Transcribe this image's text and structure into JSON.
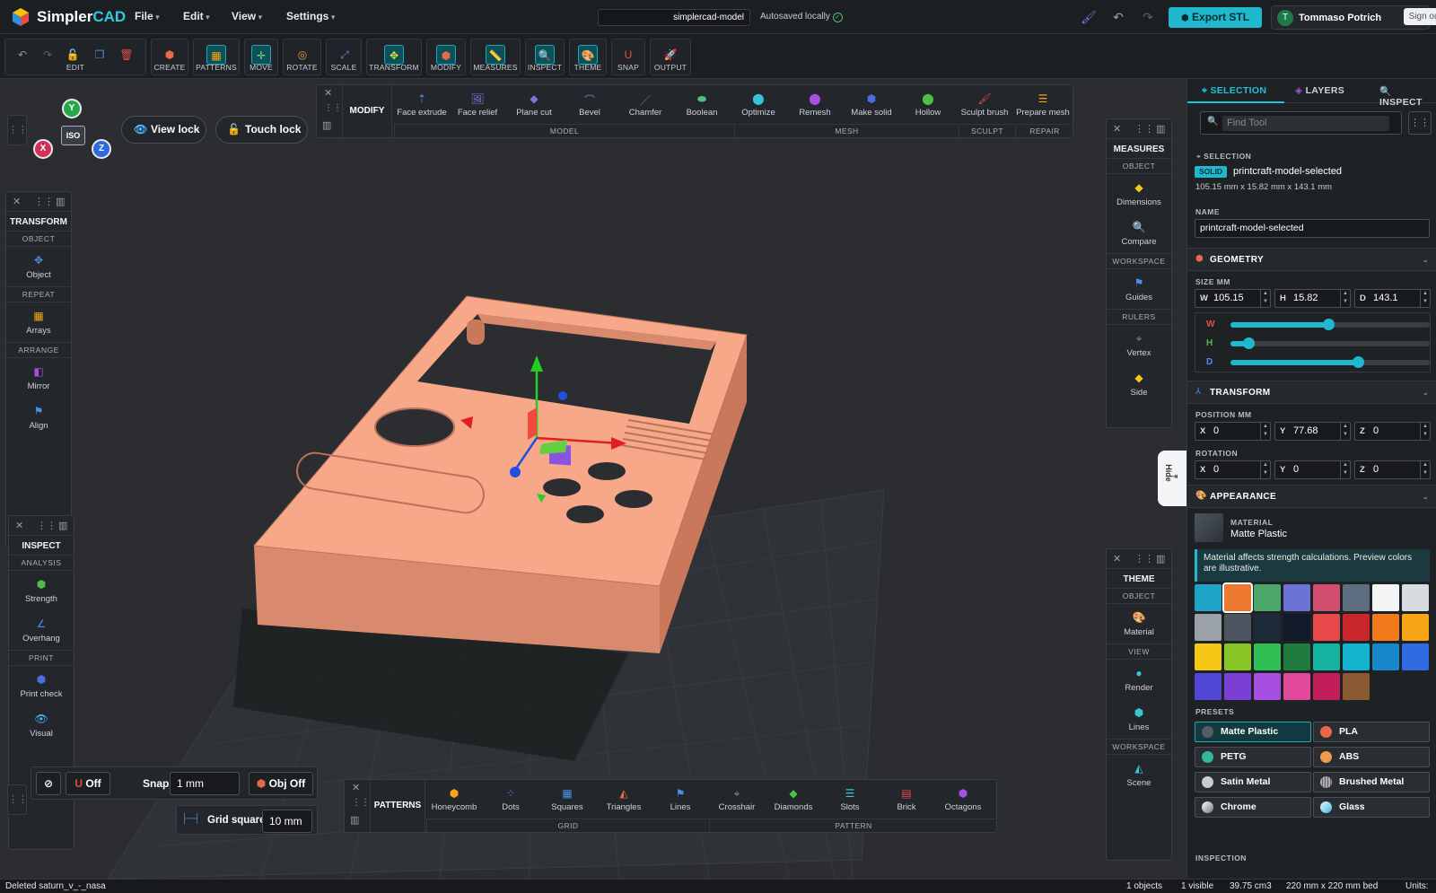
{
  "app": {
    "logo_plain": "Simpler",
    "logo_accent": "CAD"
  },
  "topbar": {
    "menus": [
      "File",
      "Edit",
      "View",
      "Settings"
    ],
    "model_name": "simplercad-model",
    "autosave": "Autosaved locally",
    "export_label": "Export STL",
    "user_initial": "T",
    "user_name": "Tommaso Potrich",
    "signout": "Sign out"
  },
  "ribbon": {
    "groups": [
      "EDIT",
      "CREATE",
      "PATTERNS",
      "MOVE",
      "ROTATE",
      "SCALE",
      "TRANSFORM",
      "MODIFY",
      "MEASURES",
      "INSPECT",
      "THEME",
      "SNAP",
      "OUTPUT"
    ]
  },
  "viewport": {
    "iso": "ISO",
    "axes": {
      "x": "X",
      "y": "Y",
      "z": "Z"
    },
    "view_lock": "View lock",
    "touch_lock": "Touch lock",
    "hide": "Hide"
  },
  "modify_bar": {
    "title": "MODIFY",
    "buttons": [
      "Face extrude",
      "Face relief",
      "Plane cut",
      "Bevel",
      "Chamfer",
      "Boolean",
      "Optimize",
      "Remesh",
      "Make solid",
      "Hollow",
      "Sculpt brush",
      "Prepare mesh"
    ],
    "sections": [
      "MODEL",
      "MESH",
      "SCULPT",
      "REPAIR"
    ]
  },
  "patterns_bar": {
    "title": "PATTERNS",
    "buttons": [
      "Honeycomb",
      "Dots",
      "Squares",
      "Triangles",
      "Lines",
      "Crosshair",
      "Diamonds",
      "Slots",
      "Brick",
      "Octagons"
    ],
    "sections": [
      "GRID",
      "PATTERN"
    ]
  },
  "transform_panel": {
    "title": "TRANSFORM",
    "sec1": "OBJECT",
    "item1": "Object",
    "sec2": "REPEAT",
    "item2": "Arrays",
    "sec3": "ARRANGE",
    "item3": "Mirror",
    "item4": "Align"
  },
  "inspect_panel": {
    "title": "INSPECT",
    "sec1": "ANALYSIS",
    "item1": "Strength",
    "item2": "Overhang",
    "sec2": "PRINT",
    "item3": "Print check",
    "item4": "Visual"
  },
  "measures_panel": {
    "title": "MEASURES",
    "sec1": "OBJECT",
    "item1": "Dimensions",
    "item2": "Compare",
    "sec2": "WORKSPACE",
    "item3": "Guides",
    "sec3": "RULERS",
    "item4": "Vertex",
    "item5": "Side"
  },
  "theme_panel": {
    "title": "THEME",
    "sec1": "OBJECT",
    "item1": "Material",
    "sec2": "VIEW",
    "item2": "Render",
    "item3": "Lines",
    "sec3": "WORKSPACE",
    "item4": "Scene"
  },
  "snap": {
    "off1": "Off",
    "snap_grid": "Snap Grid",
    "grid_value": "1 mm",
    "obj_off": "Obj Off",
    "grid_square": "Grid square",
    "grid_square_value": "10 mm"
  },
  "status": {
    "left": "Deleted saturn_v_-_nasa",
    "objects": "1 objects",
    "visible": "1 visible",
    "volume": "39.75 cm3",
    "bed": "220 mm x 220 mm bed",
    "units": "Units:"
  },
  "sidebar": {
    "tabs": [
      "SELECTION",
      "LAYERS",
      "INSPECT"
    ],
    "find_placeholder": "Find Tool",
    "selection_label": "SELECTION",
    "solid_badge": "SOLID",
    "selected_name": "printcraft-model-selected",
    "dims": "105.15 mm x 15.82 mm x 143.1 mm",
    "name_label": "NAME",
    "name_value": "printcraft-model-selected",
    "geometry": "GEOMETRY",
    "size_label": "SIZE MM",
    "size": {
      "w": "105.15",
      "h": "15.82",
      "d": "143.1"
    },
    "size_letters": {
      "w": "W",
      "h": "H",
      "d": "D"
    },
    "sliders": {
      "w": 0.49,
      "h": 0.09,
      "d": 0.64
    },
    "transform": "TRANSFORM",
    "position_label": "POSITION MM",
    "position": {
      "x": "0",
      "y": "77.68",
      "z": "0"
    },
    "pos_letters": {
      "x": "X",
      "y": "Y",
      "z": "Z"
    },
    "rotation_label": "ROTATION",
    "rotation": {
      "x": "0",
      "y": "0",
      "z": "0"
    },
    "appearance": "APPEARANCE",
    "material_label": "MATERIAL",
    "material_value": "Matte Plastic",
    "note": "Material affects strength calculations. Preview colors are illustrative.",
    "presets_label": "PRESETS",
    "presets": [
      "Matte Plastic",
      "PLA",
      "PETG",
      "ABS",
      "Satin Metal",
      "Brushed Metal",
      "Chrome",
      "Glass"
    ],
    "inspection_label": "INSPECTION",
    "swatches": [
      "#1fa4c8",
      "#ee7a2f",
      "#4aa66a",
      "#6b74d6",
      "#d34f72",
      "#5c6e80",
      "#f4f5f6",
      "#d8dce0",
      "#9aa1a8",
      "#4c5560",
      "#1d2a38",
      "#101a28",
      "#e8484a",
      "#c9262d",
      "#f27a1a",
      "#f5a516",
      "#f5c816",
      "#88c626",
      "#2fbf55",
      "#1e7a3e",
      "#16b3a0",
      "#12b4d0",
      "#1687c8",
      "#2f6be0",
      "#5147d6",
      "#7b3fd6",
      "#a74fe0",
      "#e0489a",
      "#c21f5a",
      "#8a5a32"
    ]
  }
}
